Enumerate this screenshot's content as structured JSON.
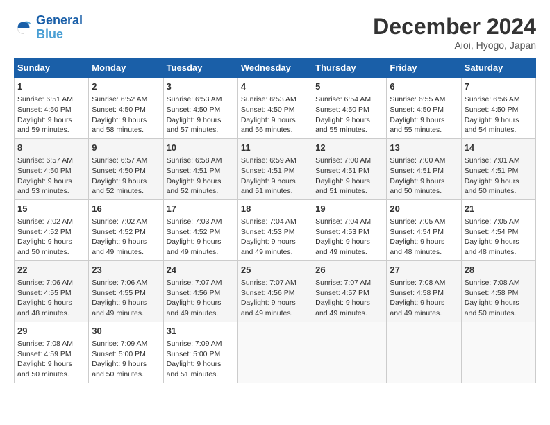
{
  "header": {
    "logo_general": "General",
    "logo_blue": "Blue",
    "title": "December 2024",
    "location": "Aioi, Hyogo, Japan"
  },
  "calendar": {
    "days_of_week": [
      "Sunday",
      "Monday",
      "Tuesday",
      "Wednesday",
      "Thursday",
      "Friday",
      "Saturday"
    ],
    "weeks": [
      [
        {
          "day": "",
          "info": ""
        },
        {
          "day": "2",
          "info": "Sunrise: 6:52 AM\nSunset: 4:50 PM\nDaylight: 9 hours and 58 minutes."
        },
        {
          "day": "3",
          "info": "Sunrise: 6:53 AM\nSunset: 4:50 PM\nDaylight: 9 hours and 57 minutes."
        },
        {
          "day": "4",
          "info": "Sunrise: 6:53 AM\nSunset: 4:50 PM\nDaylight: 9 hours and 56 minutes."
        },
        {
          "day": "5",
          "info": "Sunrise: 6:54 AM\nSunset: 4:50 PM\nDaylight: 9 hours and 55 minutes."
        },
        {
          "day": "6",
          "info": "Sunrise: 6:55 AM\nSunset: 4:50 PM\nDaylight: 9 hours and 55 minutes."
        },
        {
          "day": "7",
          "info": "Sunrise: 6:56 AM\nSunset: 4:50 PM\nDaylight: 9 hours and 54 minutes."
        }
      ],
      [
        {
          "day": "8",
          "info": "Sunrise: 6:57 AM\nSunset: 4:50 PM\nDaylight: 9 hours and 53 minutes."
        },
        {
          "day": "9",
          "info": "Sunrise: 6:57 AM\nSunset: 4:50 PM\nDaylight: 9 hours and 52 minutes."
        },
        {
          "day": "10",
          "info": "Sunrise: 6:58 AM\nSunset: 4:51 PM\nDaylight: 9 hours and 52 minutes."
        },
        {
          "day": "11",
          "info": "Sunrise: 6:59 AM\nSunset: 4:51 PM\nDaylight: 9 hours and 51 minutes."
        },
        {
          "day": "12",
          "info": "Sunrise: 7:00 AM\nSunset: 4:51 PM\nDaylight: 9 hours and 51 minutes."
        },
        {
          "day": "13",
          "info": "Sunrise: 7:00 AM\nSunset: 4:51 PM\nDaylight: 9 hours and 50 minutes."
        },
        {
          "day": "14",
          "info": "Sunrise: 7:01 AM\nSunset: 4:51 PM\nDaylight: 9 hours and 50 minutes."
        }
      ],
      [
        {
          "day": "15",
          "info": "Sunrise: 7:02 AM\nSunset: 4:52 PM\nDaylight: 9 hours and 50 minutes."
        },
        {
          "day": "16",
          "info": "Sunrise: 7:02 AM\nSunset: 4:52 PM\nDaylight: 9 hours and 49 minutes."
        },
        {
          "day": "17",
          "info": "Sunrise: 7:03 AM\nSunset: 4:52 PM\nDaylight: 9 hours and 49 minutes."
        },
        {
          "day": "18",
          "info": "Sunrise: 7:04 AM\nSunset: 4:53 PM\nDaylight: 9 hours and 49 minutes."
        },
        {
          "day": "19",
          "info": "Sunrise: 7:04 AM\nSunset: 4:53 PM\nDaylight: 9 hours and 49 minutes."
        },
        {
          "day": "20",
          "info": "Sunrise: 7:05 AM\nSunset: 4:54 PM\nDaylight: 9 hours and 48 minutes."
        },
        {
          "day": "21",
          "info": "Sunrise: 7:05 AM\nSunset: 4:54 PM\nDaylight: 9 hours and 48 minutes."
        }
      ],
      [
        {
          "day": "22",
          "info": "Sunrise: 7:06 AM\nSunset: 4:55 PM\nDaylight: 9 hours and 48 minutes."
        },
        {
          "day": "23",
          "info": "Sunrise: 7:06 AM\nSunset: 4:55 PM\nDaylight: 9 hours and 49 minutes."
        },
        {
          "day": "24",
          "info": "Sunrise: 7:07 AM\nSunset: 4:56 PM\nDaylight: 9 hours and 49 minutes."
        },
        {
          "day": "25",
          "info": "Sunrise: 7:07 AM\nSunset: 4:56 PM\nDaylight: 9 hours and 49 minutes."
        },
        {
          "day": "26",
          "info": "Sunrise: 7:07 AM\nSunset: 4:57 PM\nDaylight: 9 hours and 49 minutes."
        },
        {
          "day": "27",
          "info": "Sunrise: 7:08 AM\nSunset: 4:58 PM\nDaylight: 9 hours and 49 minutes."
        },
        {
          "day": "28",
          "info": "Sunrise: 7:08 AM\nSunset: 4:58 PM\nDaylight: 9 hours and 50 minutes."
        }
      ],
      [
        {
          "day": "29",
          "info": "Sunrise: 7:08 AM\nSunset: 4:59 PM\nDaylight: 9 hours and 50 minutes."
        },
        {
          "day": "30",
          "info": "Sunrise: 7:09 AM\nSunset: 5:00 PM\nDaylight: 9 hours and 50 minutes."
        },
        {
          "day": "31",
          "info": "Sunrise: 7:09 AM\nSunset: 5:00 PM\nDaylight: 9 hours and 51 minutes."
        },
        {
          "day": "",
          "info": ""
        },
        {
          "day": "",
          "info": ""
        },
        {
          "day": "",
          "info": ""
        },
        {
          "day": "",
          "info": ""
        }
      ]
    ],
    "week0_sunday": {
      "day": "1",
      "info": "Sunrise: 6:51 AM\nSunset: 4:50 PM\nDaylight: 9 hours and 59 minutes."
    }
  }
}
